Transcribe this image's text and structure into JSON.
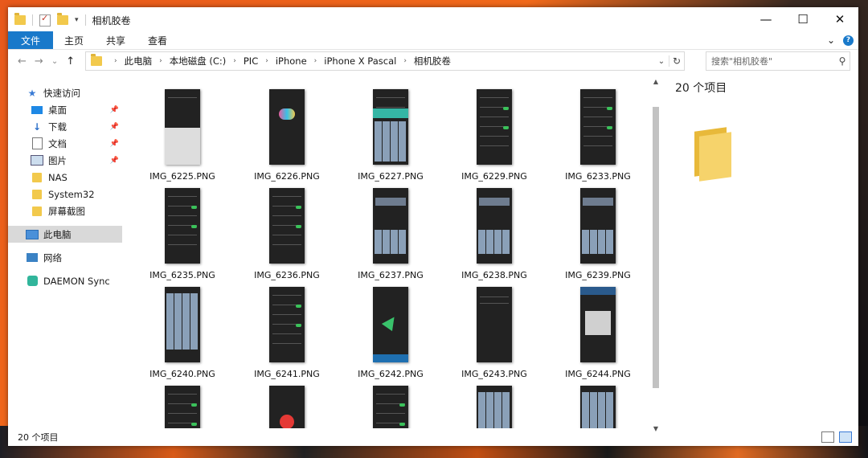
{
  "window": {
    "title": "相机胶卷",
    "controls": {
      "minimize": "—",
      "maximize": "☐",
      "close": "✕"
    }
  },
  "ribbon": {
    "tabs": [
      "文件",
      "主页",
      "共享",
      "查看"
    ],
    "expand": "⌄",
    "help": "?"
  },
  "nav": {
    "back": "←",
    "forward": "→",
    "recent": "⌄",
    "up": "↑"
  },
  "address": {
    "crumbs": [
      "此电脑",
      "本地磁盘 (C:)",
      "PIC",
      "iPhone",
      "iPhone X Pascal",
      "相机胶卷"
    ],
    "dropdown": "⌄",
    "refresh": "↻"
  },
  "search": {
    "placeholder": "搜索\"相机胶卷\"",
    "icon": "search-icon"
  },
  "sidebar": {
    "items": [
      {
        "label": "快速访问",
        "icon": "star-icon",
        "pinned": false
      },
      {
        "label": "桌面",
        "icon": "desktop-icon",
        "pinned": true
      },
      {
        "label": "下载",
        "icon": "download-icon",
        "pinned": true
      },
      {
        "label": "文档",
        "icon": "document-icon",
        "pinned": true
      },
      {
        "label": "图片",
        "icon": "pictures-icon",
        "pinned": true
      },
      {
        "label": "NAS",
        "icon": "folder-icon",
        "pinned": false
      },
      {
        "label": "System32",
        "icon": "folder-icon",
        "pinned": false
      },
      {
        "label": "屏幕截图",
        "icon": "folder-icon",
        "pinned": false
      },
      {
        "label": "此电脑",
        "icon": "computer-icon",
        "pinned": false,
        "selected": true
      },
      {
        "label": "网络",
        "icon": "network-icon",
        "pinned": false
      },
      {
        "label": "DAEMON Sync",
        "icon": "daemon-sync-icon",
        "pinned": false
      }
    ]
  },
  "files": [
    {
      "name": "IMG_6225.PNG",
      "style": "light"
    },
    {
      "name": "IMG_6226.PNG",
      "style": "heart"
    },
    {
      "name": "IMG_6227.PNG",
      "style": "teal"
    },
    {
      "name": "IMG_6229.PNG",
      "style": "list"
    },
    {
      "name": "IMG_6233.PNG",
      "style": "list"
    },
    {
      "name": "IMG_6235.PNG",
      "style": "list"
    },
    {
      "name": "IMG_6236.PNG",
      "style": "list"
    },
    {
      "name": "IMG_6237.PNG",
      "style": "tiles"
    },
    {
      "name": "IMG_6238.PNG",
      "style": "tiles"
    },
    {
      "name": "IMG_6239.PNG",
      "style": "tiles"
    },
    {
      "name": "IMG_6240.PNG",
      "style": "photos"
    },
    {
      "name": "IMG_6241.PNG",
      "style": "list"
    },
    {
      "name": "IMG_6242.PNG",
      "style": "arrow"
    },
    {
      "name": "IMG_6243.PNG",
      "style": "dark"
    },
    {
      "name": "IMG_6244.PNG",
      "style": "dialog"
    },
    {
      "name": "",
      "style": "list"
    },
    {
      "name": "",
      "style": "record"
    },
    {
      "name": "",
      "style": "list"
    },
    {
      "name": "",
      "style": "photos"
    },
    {
      "name": "",
      "style": "photos"
    }
  ],
  "details": {
    "count": "20 个项目"
  },
  "status": {
    "count": "20 个项目"
  },
  "colors": {
    "accent": "#1979ca",
    "folder": "#f2c94c",
    "selection": "#d9d9d9"
  }
}
